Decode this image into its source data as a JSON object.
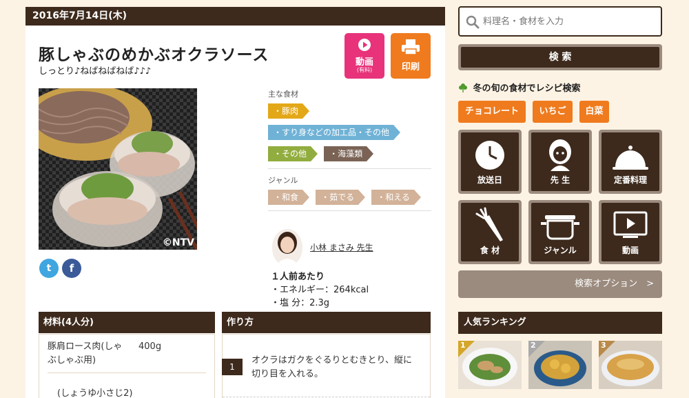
{
  "recipe": {
    "date": "2016年7月14日(木)",
    "title": "豚しゃぶのめかぶオクラソース",
    "subtitle": "しっとり♪ねばねばねば♪♪♪",
    "video_label": "動画",
    "video_sub": "(有料)",
    "print_label": "印刷",
    "photo_copyright": "©NTV",
    "main_ingredients_label": "主な食材",
    "main_ingredients": [
      "・豚肉",
      "・すり身などの加工品・その他",
      "・その他",
      "・海藻類"
    ],
    "genre_label": "ジャンル",
    "genres": [
      "・和食",
      "・茹でる",
      "・和える"
    ],
    "teacher": "小林 まさみ 先生",
    "nutrition_head": "１人前あたり",
    "nutrition": [
      "・エネルギー：264kcal",
      "・塩 分：2.3g"
    ],
    "social": {
      "twitter": "t",
      "facebook": "f"
    }
  },
  "ingredients": {
    "header": "材料(4人分)",
    "items": [
      {
        "name": "豚肩ロース肉(しゃぶしゃぶ用)",
        "amount": "400g"
      },
      {
        "name": "(しょうゆ小さじ2)",
        "amount": ""
      }
    ]
  },
  "steps": {
    "header": "作り方",
    "items": [
      {
        "num": "1",
        "text": "オクラはガクをぐるりとむきとり、縦に切り目を入れる。"
      }
    ]
  },
  "sidebar": {
    "search_placeholder": "料理名・食材を入力",
    "search_button": "検 索",
    "season_title": "冬の旬の食材でレシピ検索",
    "season_tags": [
      "チョコレート",
      "いちご",
      "白菜"
    ],
    "tiles": [
      "放送日",
      "先 生",
      "定番料理",
      "食 材",
      "ジャンル",
      "動画"
    ],
    "search_options": "検索オプション　>",
    "ranking_title": "人気ランキング",
    "ranks": [
      "1",
      "2",
      "3"
    ]
  },
  "colors": {
    "header_brown": "#3d2a1c",
    "video_pink": "#e8327a",
    "print_orange": "#ef7b1e",
    "tile_taupe": "#9b8b7e",
    "rank_gold": "#d4a62a",
    "rank_silver": "#a9a9a9",
    "rank_bronze": "#b98a4a"
  }
}
